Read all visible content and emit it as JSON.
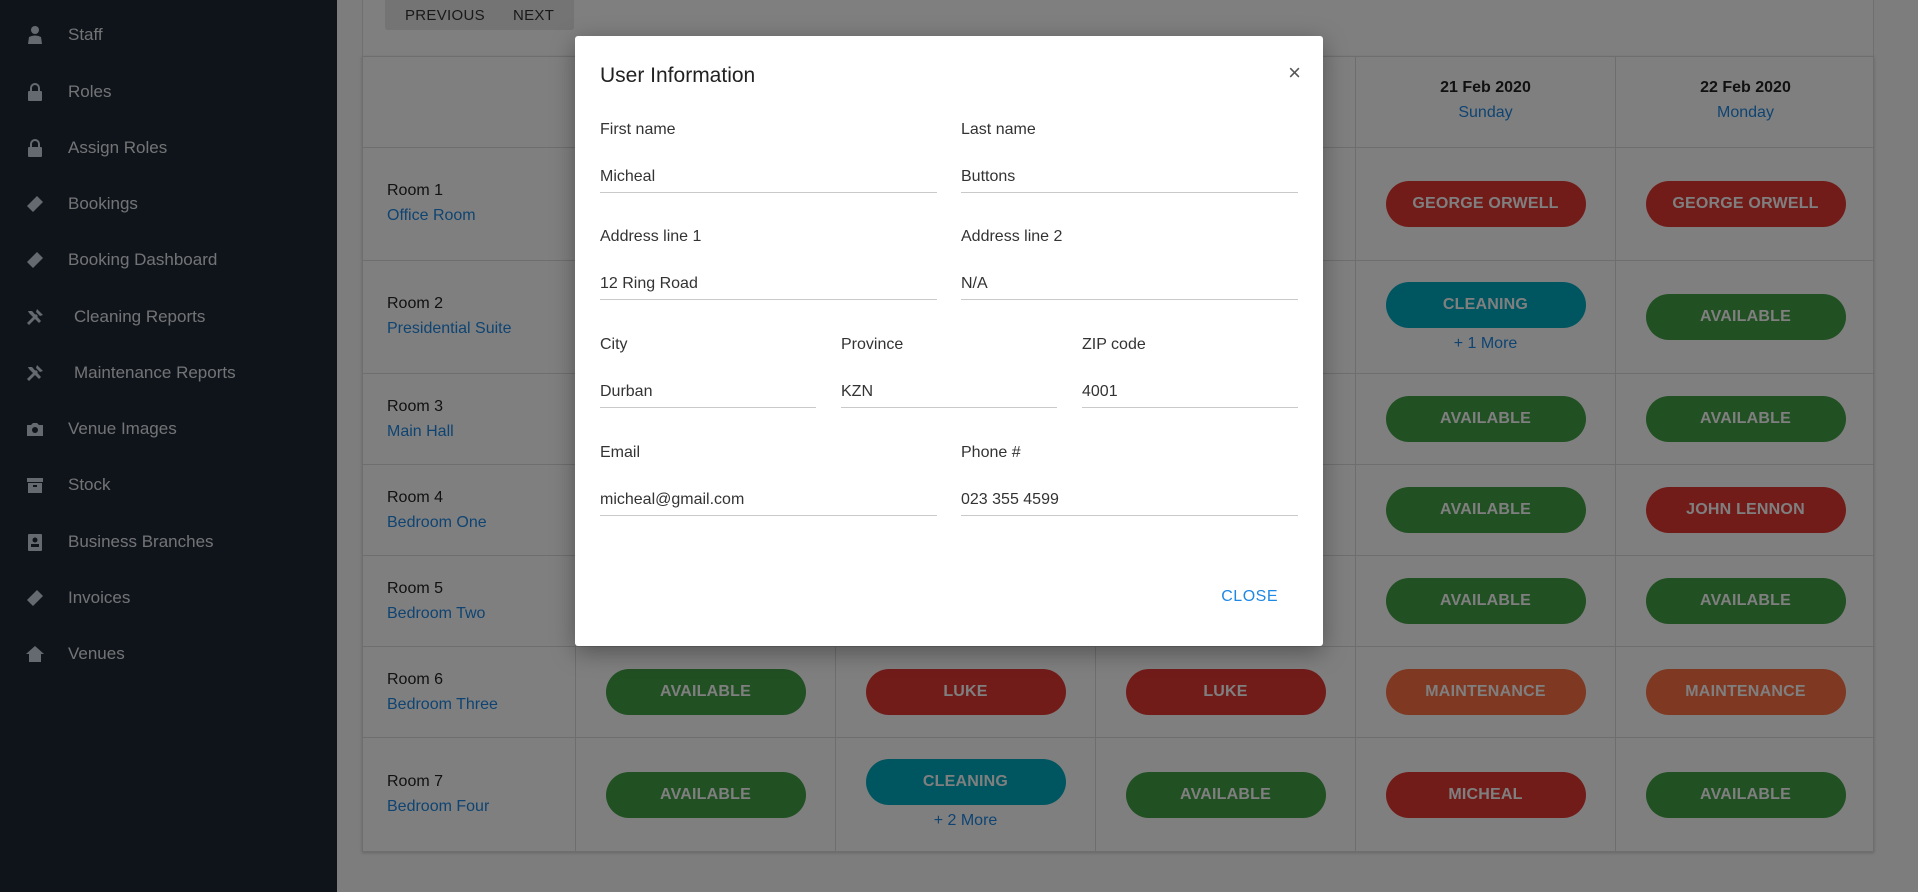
{
  "sidebar": {
    "items": [
      {
        "label": "Staff",
        "icon": "user-tie-icon"
      },
      {
        "label": "Roles",
        "icon": "lock-icon"
      },
      {
        "label": "Assign Roles",
        "icon": "lock-icon"
      },
      {
        "label": "Bookings",
        "icon": "ticket-icon"
      },
      {
        "label": "Booking Dashboard",
        "icon": "ticket-icon"
      },
      {
        "label": "Cleaning Reports",
        "icon": "tools-icon"
      },
      {
        "label": "Maintenance Reports",
        "icon": "tools-icon"
      },
      {
        "label": "Venue Images",
        "icon": "camera-icon"
      },
      {
        "label": "Stock",
        "icon": "archive-icon"
      },
      {
        "label": "Business Branches",
        "icon": "id-card-icon"
      },
      {
        "label": "Invoices",
        "icon": "ticket-icon"
      },
      {
        "label": "Venues",
        "icon": "home-icon"
      }
    ]
  },
  "toolbar": {
    "previous_label": "PREVIOUS",
    "next_label": "NEXT"
  },
  "schedule": {
    "headers": [
      {
        "date": "21 Feb 2020",
        "day": "Sunday"
      },
      {
        "date": "22 Feb 2020",
        "day": "Monday"
      }
    ],
    "rooms": [
      {
        "name": "Room 1",
        "type": "Office Room"
      },
      {
        "name": "Room 2",
        "type": "Presidential Suite"
      },
      {
        "name": "Room 3",
        "type": "Main Hall"
      },
      {
        "name": "Room 4",
        "type": "Bedroom One"
      },
      {
        "name": "Room 5",
        "type": "Bedroom Two"
      },
      {
        "name": "Room 6",
        "type": "Bedroom Three"
      },
      {
        "name": "Room 7",
        "type": "Bedroom Four"
      }
    ],
    "bookings": {
      "r1c4": "GEORGE ORWELL",
      "r1c5": "GEORGE ORWELL",
      "r2c4": "CLEANING",
      "r2c4_more": "+ 1 More",
      "r2c5": "AVAILABLE",
      "r3c4": "AVAILABLE",
      "r3c5": "AVAILABLE",
      "r4c4": "AVAILABLE",
      "r4c5": "JOHN LENNON",
      "r5c4": "AVAILABLE",
      "r5c5": "AVAILABLE",
      "r6c1": "AVAILABLE",
      "r6c2": "LUKE",
      "r6c3": "LUKE",
      "r6c4": "MAINTENANCE",
      "r6c5": "MAINTENANCE",
      "r7c1": "AVAILABLE",
      "r7c2": "CLEANING",
      "r7c2_more": "+ 2 More",
      "r7c3": "AVAILABLE",
      "r7c4": "MICHEAL",
      "r7c5": "AVAILABLE"
    },
    "colors": {
      "available": "#43a047",
      "booked": "#e53935",
      "cleaning": "#00acc1",
      "maintenance": "#ff7043"
    }
  },
  "modal": {
    "title": "User Information",
    "close_icon": "×",
    "close_label": "CLOSE",
    "fields": {
      "first_name": {
        "label": "First name",
        "value": "Micheal"
      },
      "last_name": {
        "label": "Last name",
        "value": "Buttons"
      },
      "address1": {
        "label": "Address line 1",
        "value": "12 Ring Road"
      },
      "address2": {
        "label": "Address line 2",
        "value": "N/A"
      },
      "city": {
        "label": "City",
        "value": "Durban"
      },
      "province": {
        "label": "Province",
        "value": "KZN"
      },
      "zip": {
        "label": "ZIP code",
        "value": "4001"
      },
      "email": {
        "label": "Email",
        "value": "micheal@gmail.com"
      },
      "phone": {
        "label": "Phone #",
        "value": "023 355 4599"
      }
    }
  }
}
